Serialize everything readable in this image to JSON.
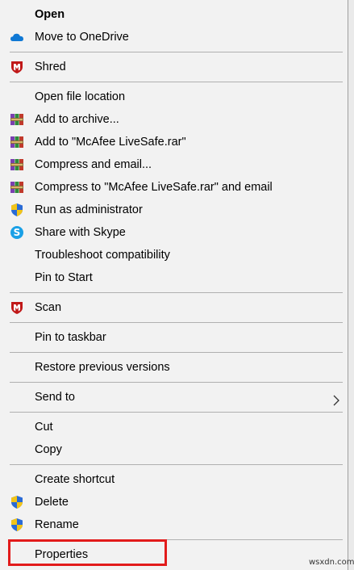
{
  "menu": {
    "open": "Open",
    "onedrive": "Move to OneDrive",
    "shred": "Shred",
    "open_location": "Open file location",
    "add_archive": "Add to archive...",
    "add_rar": "Add to \"McAfee LiveSafe.rar\"",
    "compress_email": "Compress and email...",
    "compress_rar_email": "Compress to \"McAfee LiveSafe.rar\" and email",
    "run_admin": "Run as administrator",
    "share_skype": "Share with Skype",
    "troubleshoot": "Troubleshoot compatibility",
    "pin_start": "Pin to Start",
    "scan": "Scan",
    "pin_taskbar": "Pin to taskbar",
    "restore": "Restore previous versions",
    "send_to": "Send to",
    "cut": "Cut",
    "copy": "Copy",
    "create_shortcut": "Create shortcut",
    "delete": "Delete",
    "rename": "Rename",
    "properties": "Properties"
  },
  "icons": {
    "onedrive": "onedrive-cloud-icon",
    "mcafee": "mcafee-shield-icon",
    "winrar": "winrar-books-icon",
    "uac": "uac-shield-icon",
    "skype": "skype-icon",
    "chevron": "chevron-right-icon"
  },
  "colors": {
    "menu_bg": "#f2f2f2",
    "highlight_box": "#e21b1b",
    "separator": "#b0b0b0"
  },
  "watermark": "wsxdn.com"
}
